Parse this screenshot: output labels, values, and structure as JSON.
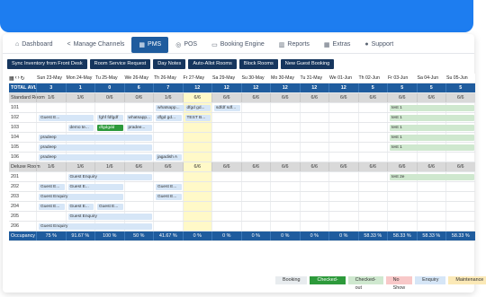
{
  "nav": [
    {
      "icon": "⌂",
      "label": "Dashboard"
    },
    {
      "icon": "<",
      "label": "Manage Channels"
    },
    {
      "icon": "▦",
      "label": "PMS"
    },
    {
      "icon": "◎",
      "label": "POS"
    },
    {
      "icon": "▭",
      "label": "Booking Engine"
    },
    {
      "icon": "▥",
      "label": "Reports"
    },
    {
      "icon": "▦",
      "label": "Extras"
    },
    {
      "icon": "●",
      "label": "Support"
    }
  ],
  "actions": [
    "Sync Inventory from Front Desk",
    "Room Service Request",
    "Day Notes",
    "Auto-Allot Rooms",
    "Block Rooms",
    "New Guest Booking"
  ],
  "dates": [
    "Sun 23-May",
    "Mon 24-May",
    "Tu 25-May",
    "We 26-May",
    "Th 27-May",
    "Fr 28-May",
    "Sa 29-May",
    "Su 30-May",
    "Mo 31-May",
    "Tu 1-Jun",
    "We 2-Jun",
    "Th 3-Jun",
    "Fr 4-Jun",
    "Sa 5-Jun",
    "Su 6-Jun"
  ],
  "date_headers": [
    "Sun 23-May",
    "Mon 24-May",
    "Tu 25-May",
    "We 26-May",
    "Th 26-May",
    "Fr 27-May",
    "Sa 29-May",
    "Su 30-May",
    "Mo 30-May",
    "Tu 31-May",
    "We 01-Jun",
    "Th 02-Jun",
    "Fr 03-Jun",
    "Sa 04-Jun",
    "Su 05-Jun"
  ],
  "total": {
    "label": "TOTAL AVL",
    "values": [
      "3",
      "1",
      "0",
      "6",
      "7",
      "12",
      "12",
      "12",
      "12",
      "12",
      "12",
      "5",
      "5",
      "5",
      "5"
    ]
  },
  "standard": {
    "label": "Standard Room",
    "values": [
      "1/6",
      "1/6",
      "0/6",
      "0/6",
      "1/6",
      "6/6",
      "6/6",
      "6/6",
      "6/6",
      "6/6",
      "6/6",
      "6/6",
      "6/6",
      "6/6",
      "6/6"
    ]
  },
  "standard_rooms": [
    "101",
    "102",
    "103",
    "104",
    "105",
    "106"
  ],
  "deluxe": {
    "label": "Deluxe Room",
    "values": [
      "1/6",
      "1/6",
      "1/6",
      "6/6",
      "6/6",
      "6/6",
      "6/6",
      "6/6",
      "6/6",
      "6/6",
      "6/6",
      "6/6",
      "6/6",
      "6/6",
      "6/6"
    ]
  },
  "deluxe_rooms": [
    "201",
    "202",
    "203",
    "204",
    "205",
    "206"
  ],
  "occupancy": {
    "label": "Occupancy",
    "values": [
      "75 %",
      "91.67 %",
      "100 %",
      "50 %",
      "41.67 %",
      "0 %",
      "0 %",
      "0 %",
      "0 %",
      "0 %",
      "0 %",
      "58.33 %",
      "58.33 %",
      "58.33 %",
      "58.33 %"
    ]
  },
  "bookings": [
    {
      "row": "101",
      "start": 4,
      "len": 1.1,
      "label": "whatsapp...",
      "status": "bk"
    },
    {
      "row": "101",
      "start": 5,
      "len": 1,
      "label": "dfgd gd...",
      "status": "bk"
    },
    {
      "row": "101",
      "start": 6,
      "len": 1,
      "label": "sdfdf sdf...",
      "status": "bk"
    },
    {
      "row": "101",
      "start": 12,
      "len": 3,
      "label": "test 1",
      "status": "co"
    },
    {
      "row": "102",
      "start": 0,
      "len": 2,
      "label": "Guest E...",
      "status": "bk"
    },
    {
      "row": "102",
      "start": 2,
      "len": 1,
      "label": "fghf fdfgdf",
      "status": "bk"
    },
    {
      "row": "102",
      "start": 3,
      "len": 1,
      "label": "whatsapp...",
      "status": "bk"
    },
    {
      "row": "102",
      "start": 4,
      "len": 1,
      "label": "dfgd gd...",
      "status": "bk"
    },
    {
      "row": "102",
      "start": 5,
      "len": 1,
      "label": "TEST B...",
      "status": "bk"
    },
    {
      "row": "102",
      "start": 12,
      "len": 3,
      "label": "test 1",
      "status": "co"
    },
    {
      "row": "103",
      "start": 1,
      "len": 1,
      "label": "demo te...",
      "status": "bk"
    },
    {
      "row": "103",
      "start": 2,
      "len": 1,
      "label": "dfgdgdd",
      "status": "ci"
    },
    {
      "row": "103",
      "start": 3,
      "len": 1,
      "label": "pradee...",
      "status": "bk"
    },
    {
      "row": "103",
      "start": 12,
      "len": 3,
      "label": "test 1",
      "status": "co"
    },
    {
      "row": "104",
      "start": 0,
      "len": 4,
      "label": "pradeep",
      "status": "bk"
    },
    {
      "row": "104",
      "start": 12,
      "len": 3,
      "label": "test 1",
      "status": "co"
    },
    {
      "row": "105",
      "start": 0,
      "len": 4,
      "label": "pradeep",
      "status": "bk"
    },
    {
      "row": "105",
      "start": 12,
      "len": 3,
      "label": "test 1",
      "status": "co"
    },
    {
      "row": "106",
      "start": 0,
      "len": 4,
      "label": "pradeep",
      "status": "bk"
    },
    {
      "row": "106",
      "start": 4,
      "len": 1,
      "label": "jagadish A",
      "status": "bk"
    },
    {
      "row": "201",
      "start": 1,
      "len": 3,
      "label": "Guest Enquiry",
      "status": "bk"
    },
    {
      "row": "201",
      "start": 12,
      "len": 3,
      "label": "test 2e",
      "status": "co"
    },
    {
      "row": "202",
      "start": 0,
      "len": 1,
      "label": "Guest E...",
      "status": "bk"
    },
    {
      "row": "202",
      "start": 1,
      "len": 2,
      "label": "Guest E...",
      "status": "bk"
    },
    {
      "row": "202",
      "start": 4,
      "len": 1,
      "label": "Guest E...",
      "status": "bk"
    },
    {
      "row": "203",
      "start": 0,
      "len": 3,
      "label": "Guest Enquiry",
      "status": "bk"
    },
    {
      "row": "203",
      "start": 4,
      "len": 1,
      "label": "Guest E...",
      "status": "bk"
    },
    {
      "row": "204",
      "start": 0,
      "len": 1,
      "label": "Guest E...",
      "status": "bk"
    },
    {
      "row": "204",
      "start": 1,
      "len": 1,
      "label": "Guest E...",
      "status": "bk"
    },
    {
      "row": "204",
      "start": 2,
      "len": 1,
      "label": "Guest E...",
      "status": "bk"
    },
    {
      "row": "205",
      "start": 1,
      "len": 3,
      "label": "Guest Enquiry",
      "status": "bk"
    },
    {
      "row": "206",
      "start": 0,
      "len": 4,
      "label": "Guest Enquiry",
      "status": "bk"
    }
  ],
  "legend": [
    {
      "label": "Booking",
      "color": "#e8ecef"
    },
    {
      "label": "Checked-in",
      "color": "#2d9a3b",
      "text": "#ffffff"
    },
    {
      "label": "Checked-out",
      "color": "#cfe8cf"
    },
    {
      "label": "No Show",
      "color": "#f8c8c8"
    },
    {
      "label": "Enquiry",
      "color": "#d6e6f7"
    },
    {
      "label": "Maintenance",
      "color": "#fbe9b7"
    }
  ]
}
